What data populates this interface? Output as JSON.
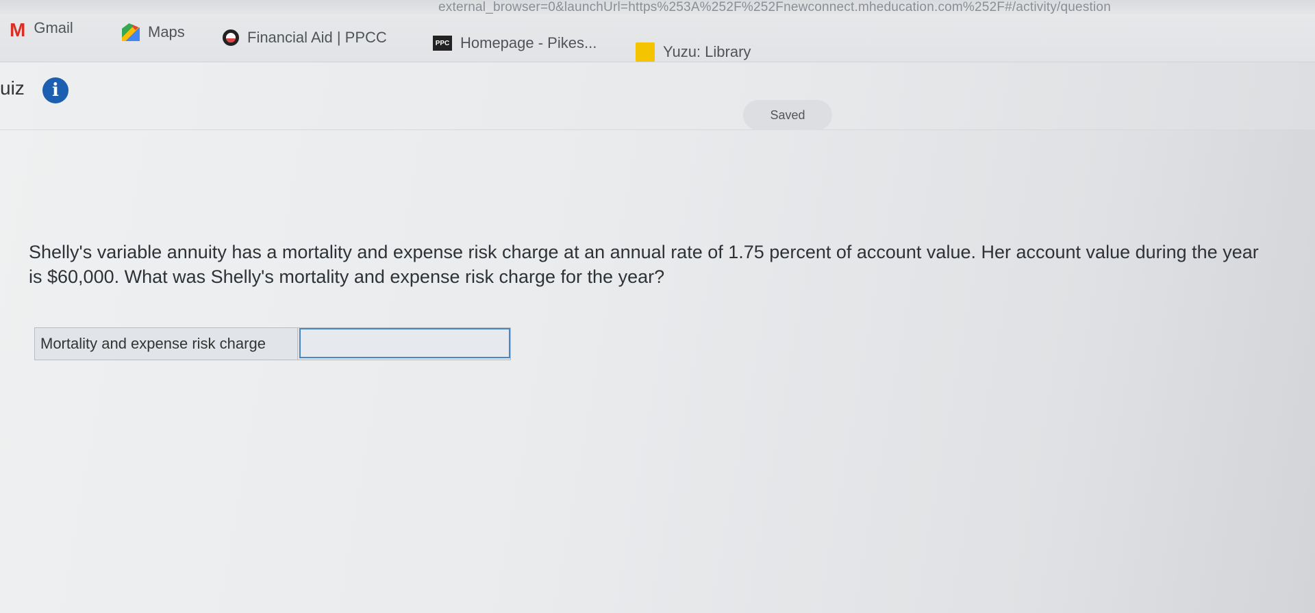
{
  "browser": {
    "url_text": "external_browser=0&launchUrl=https%253A%252F%252Fnewconnect.mheducation.com%252F#/activity/question"
  },
  "bookmarks": [
    {
      "label": "Gmail",
      "icon": "gmail-icon"
    },
    {
      "label": "Maps",
      "icon": "maps-icon"
    },
    {
      "label": "Financial Aid | PPCC",
      "icon": "financial-aid-icon"
    },
    {
      "label": "Homepage - Pikes...",
      "icon": "pikes-peak-icon"
    },
    {
      "label": "Yuzu: Library",
      "icon": "yuzu-icon"
    }
  ],
  "header": {
    "title": "uiz",
    "info_icon": "i",
    "saved_label": "Saved"
  },
  "question": {
    "text": "Shelly's variable annuity has a mortality and expense risk charge at an annual rate of 1.75 percent of account value. Her account value during the year is $60,000. What was Shelly's mortality and expense risk charge for the year?"
  },
  "answer": {
    "label": "Mortality and expense risk charge",
    "value": ""
  },
  "colors": {
    "accent": "#1c5fb0",
    "input_border": "#4a85c4"
  }
}
